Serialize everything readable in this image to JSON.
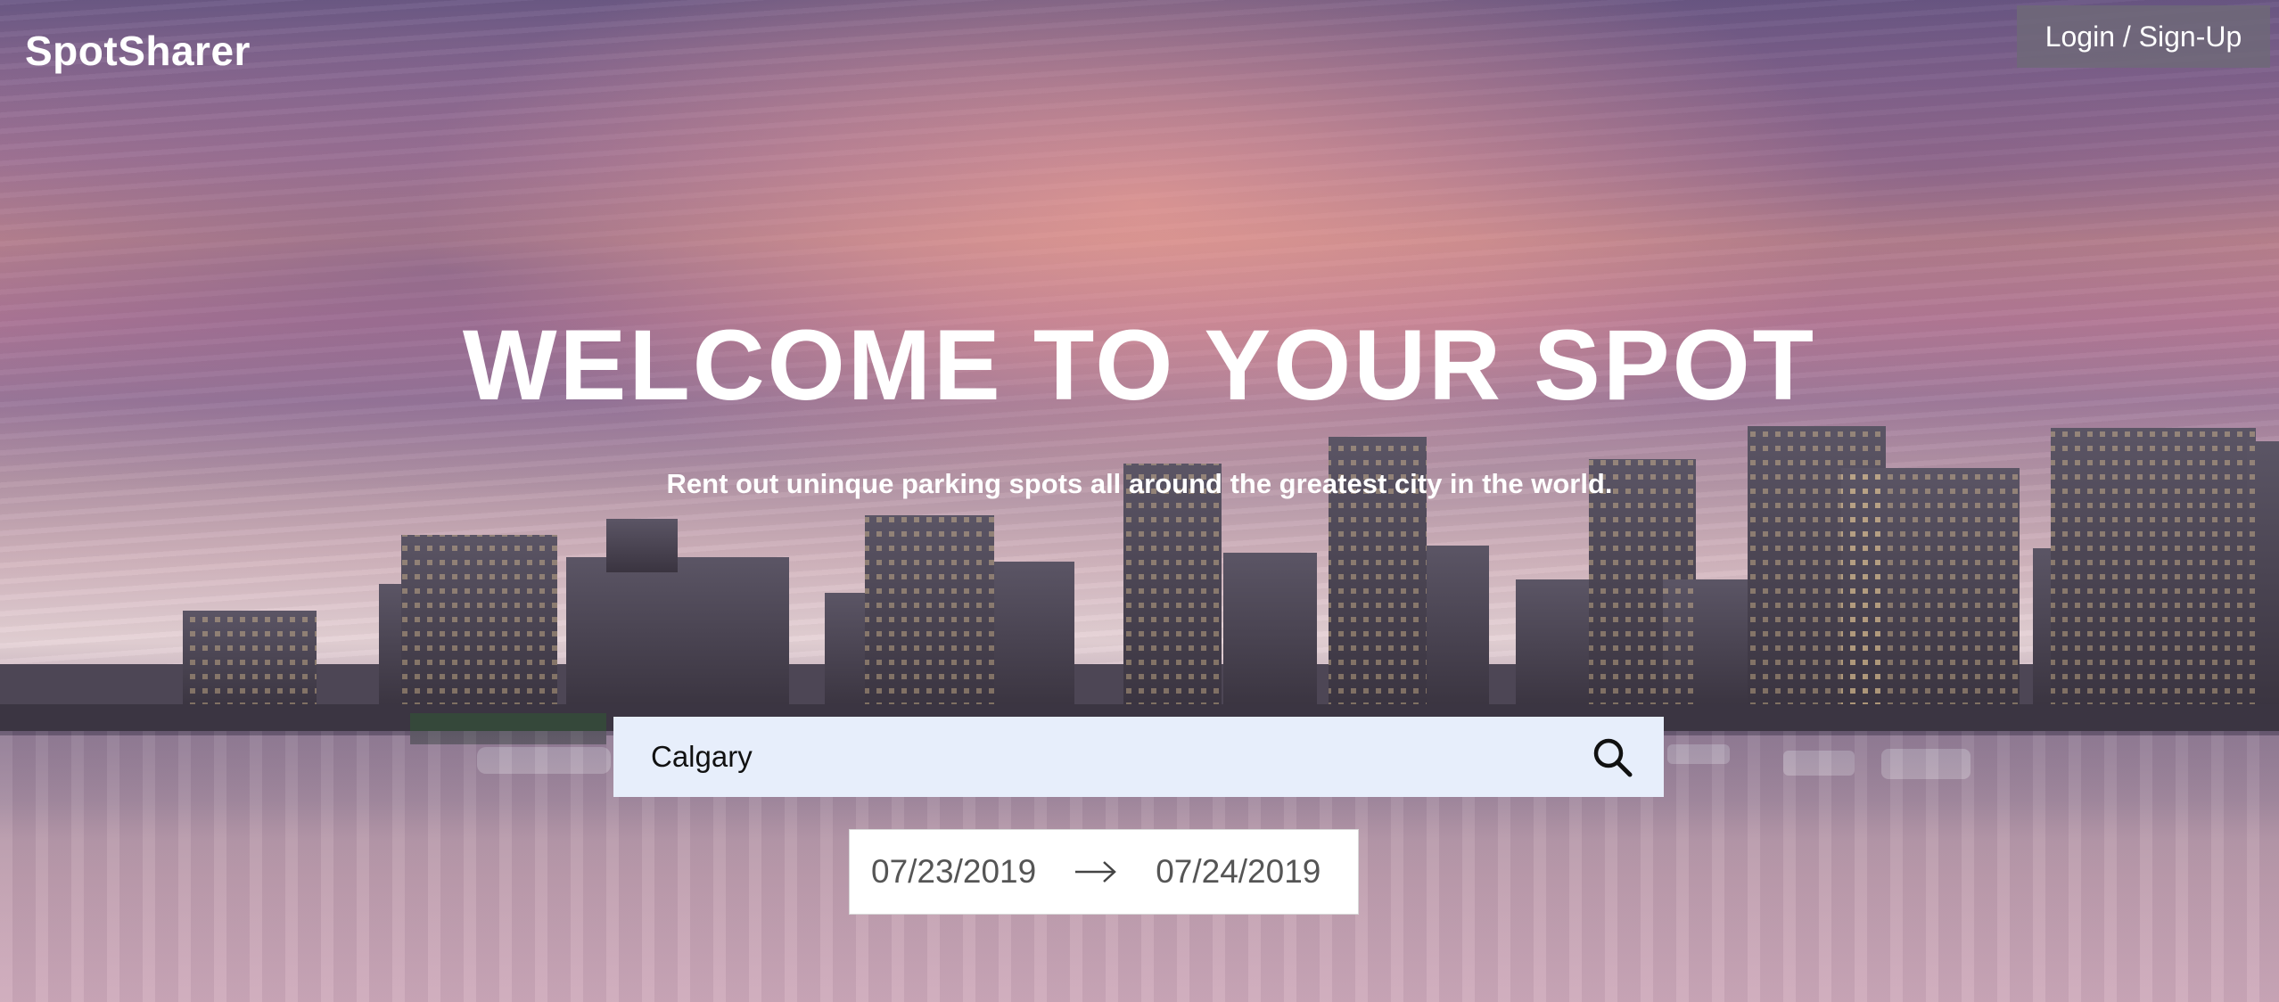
{
  "header": {
    "brand": "SpotSharer",
    "login_label": "Login / Sign-Up"
  },
  "hero": {
    "title": "WELCOME TO YOUR SPOT",
    "subtitle": "Rent out uninque parking spots all around the greatest city in the world."
  },
  "search": {
    "value": "Calgary",
    "icon": "search-icon"
  },
  "dates": {
    "start": "07/23/2019",
    "end": "07/24/2019",
    "separator_icon": "arrow-right-icon"
  },
  "colors": {
    "search_bg": "#e7eefb",
    "login_bg": "#6e6978"
  }
}
